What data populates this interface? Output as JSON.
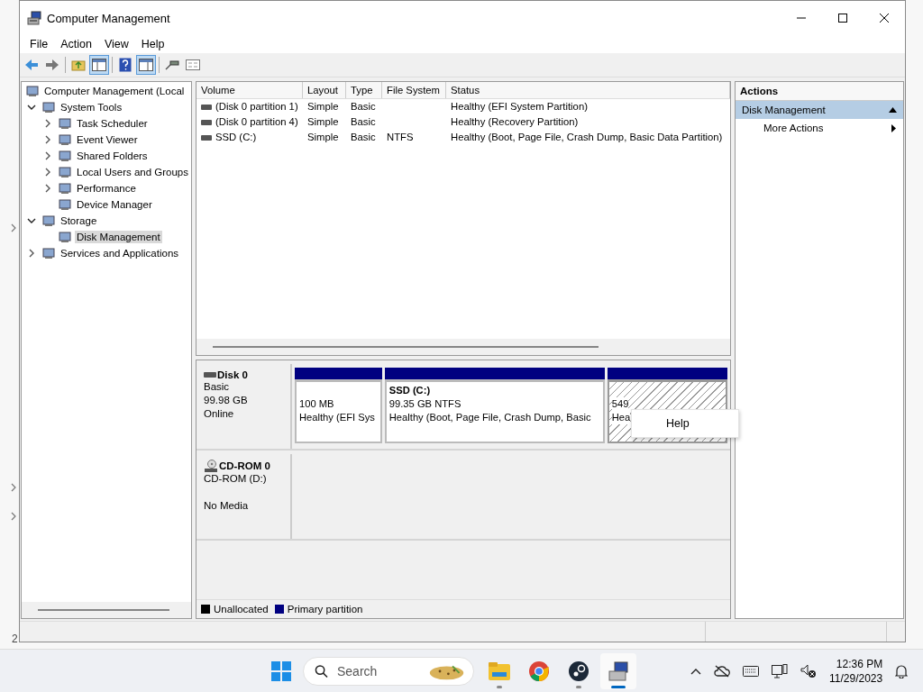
{
  "background_app": {
    "status_text": "2"
  },
  "window": {
    "title": "Computer Management"
  },
  "menu": [
    "File",
    "Action",
    "View",
    "Help"
  ],
  "toolbar": [
    {
      "kind": "button",
      "pressed": false
    },
    {
      "kind": "button",
      "pressed": false
    },
    {
      "kind": "separator"
    },
    {
      "kind": "button",
      "pressed": false
    },
    {
      "kind": "button",
      "pressed": true
    },
    {
      "kind": "separator"
    },
    {
      "kind": "button",
      "pressed": false
    },
    {
      "kind": "button",
      "pressed": true
    },
    {
      "kind": "separator"
    },
    {
      "kind": "button",
      "pressed": false
    },
    {
      "kind": "button",
      "pressed": false
    }
  ],
  "tree": {
    "items": [
      {
        "label": "Computer Management (Local",
        "selected": false,
        "children": [
          {
            "label": "System Tools",
            "expanded": true,
            "selected": false,
            "children": [
              {
                "label": "Task Scheduler",
                "expanded": false,
                "selected": false
              },
              {
                "label": "Event Viewer",
                "expanded": false,
                "selected": false
              },
              {
                "label": "Shared Folders",
                "expanded": false,
                "selected": false
              },
              {
                "label": "Local Users and Groups",
                "expanded": false,
                "selected": false
              },
              {
                "label": "Performance",
                "expanded": false,
                "selected": false
              },
              {
                "label": "Device Manager",
                "selected": false
              }
            ]
          },
          {
            "label": "Storage",
            "expanded": true,
            "selected": false,
            "children": [
              {
                "label": "Disk Management",
                "selected": true
              }
            ]
          },
          {
            "label": "Services and Applications",
            "expanded": false,
            "selected": false
          }
        ]
      }
    ]
  },
  "volumes": {
    "columns": [
      "Volume",
      "Layout",
      "Type",
      "File System",
      "Status"
    ],
    "rows": [
      [
        "(Disk 0 partition 1)",
        "Simple",
        "Basic",
        "",
        "Healthy (EFI System Partition)"
      ],
      [
        "(Disk 0 partition 4)",
        "Simple",
        "Basic",
        "",
        "Healthy (Recovery Partition)"
      ],
      [
        "SSD (C:)",
        "Simple",
        "Basic",
        "NTFS",
        "Healthy (Boot, Page File, Crash Dump, Basic Data Partition)"
      ]
    ]
  },
  "disks": [
    {
      "kind": "disk",
      "name": "Disk 0",
      "lines": [
        "Basic",
        "99.98 GB",
        "Online"
      ],
      "partitions": [
        {
          "size": "100 MB",
          "status": "Healthy (EFI Sys",
          "selected": false
        },
        {
          "title": "SSD  (C:)",
          "size": "99.35 GB NTFS",
          "status": "Healthy (Boot, Page File, Crash Dump, Basic",
          "selected": false
        },
        {
          "size": "549",
          "status": "Hea",
          "selected": true
        }
      ]
    },
    {
      "kind": "cdrom",
      "name": "CD-ROM 0",
      "lines": [
        "CD-ROM (D:)",
        "No Media"
      ]
    }
  ],
  "context_menu": [
    "Help"
  ],
  "legend": [
    {
      "label": "Unallocated",
      "color": "#000000"
    },
    {
      "label": "Primary partition",
      "color": "#000080"
    }
  ],
  "actions": {
    "title": "Actions",
    "section": "Disk Management",
    "expanded": true,
    "items": [
      "More Actions"
    ]
  },
  "taskbar": {
    "search_placeholder": "Search",
    "apps": [
      {
        "selected": false,
        "running": true
      },
      {
        "selected": false,
        "running": false
      },
      {
        "selected": false,
        "running": true
      },
      {
        "selected": true,
        "running": true
      }
    ],
    "time": "12:36 PM",
    "date": "11/29/2023"
  }
}
